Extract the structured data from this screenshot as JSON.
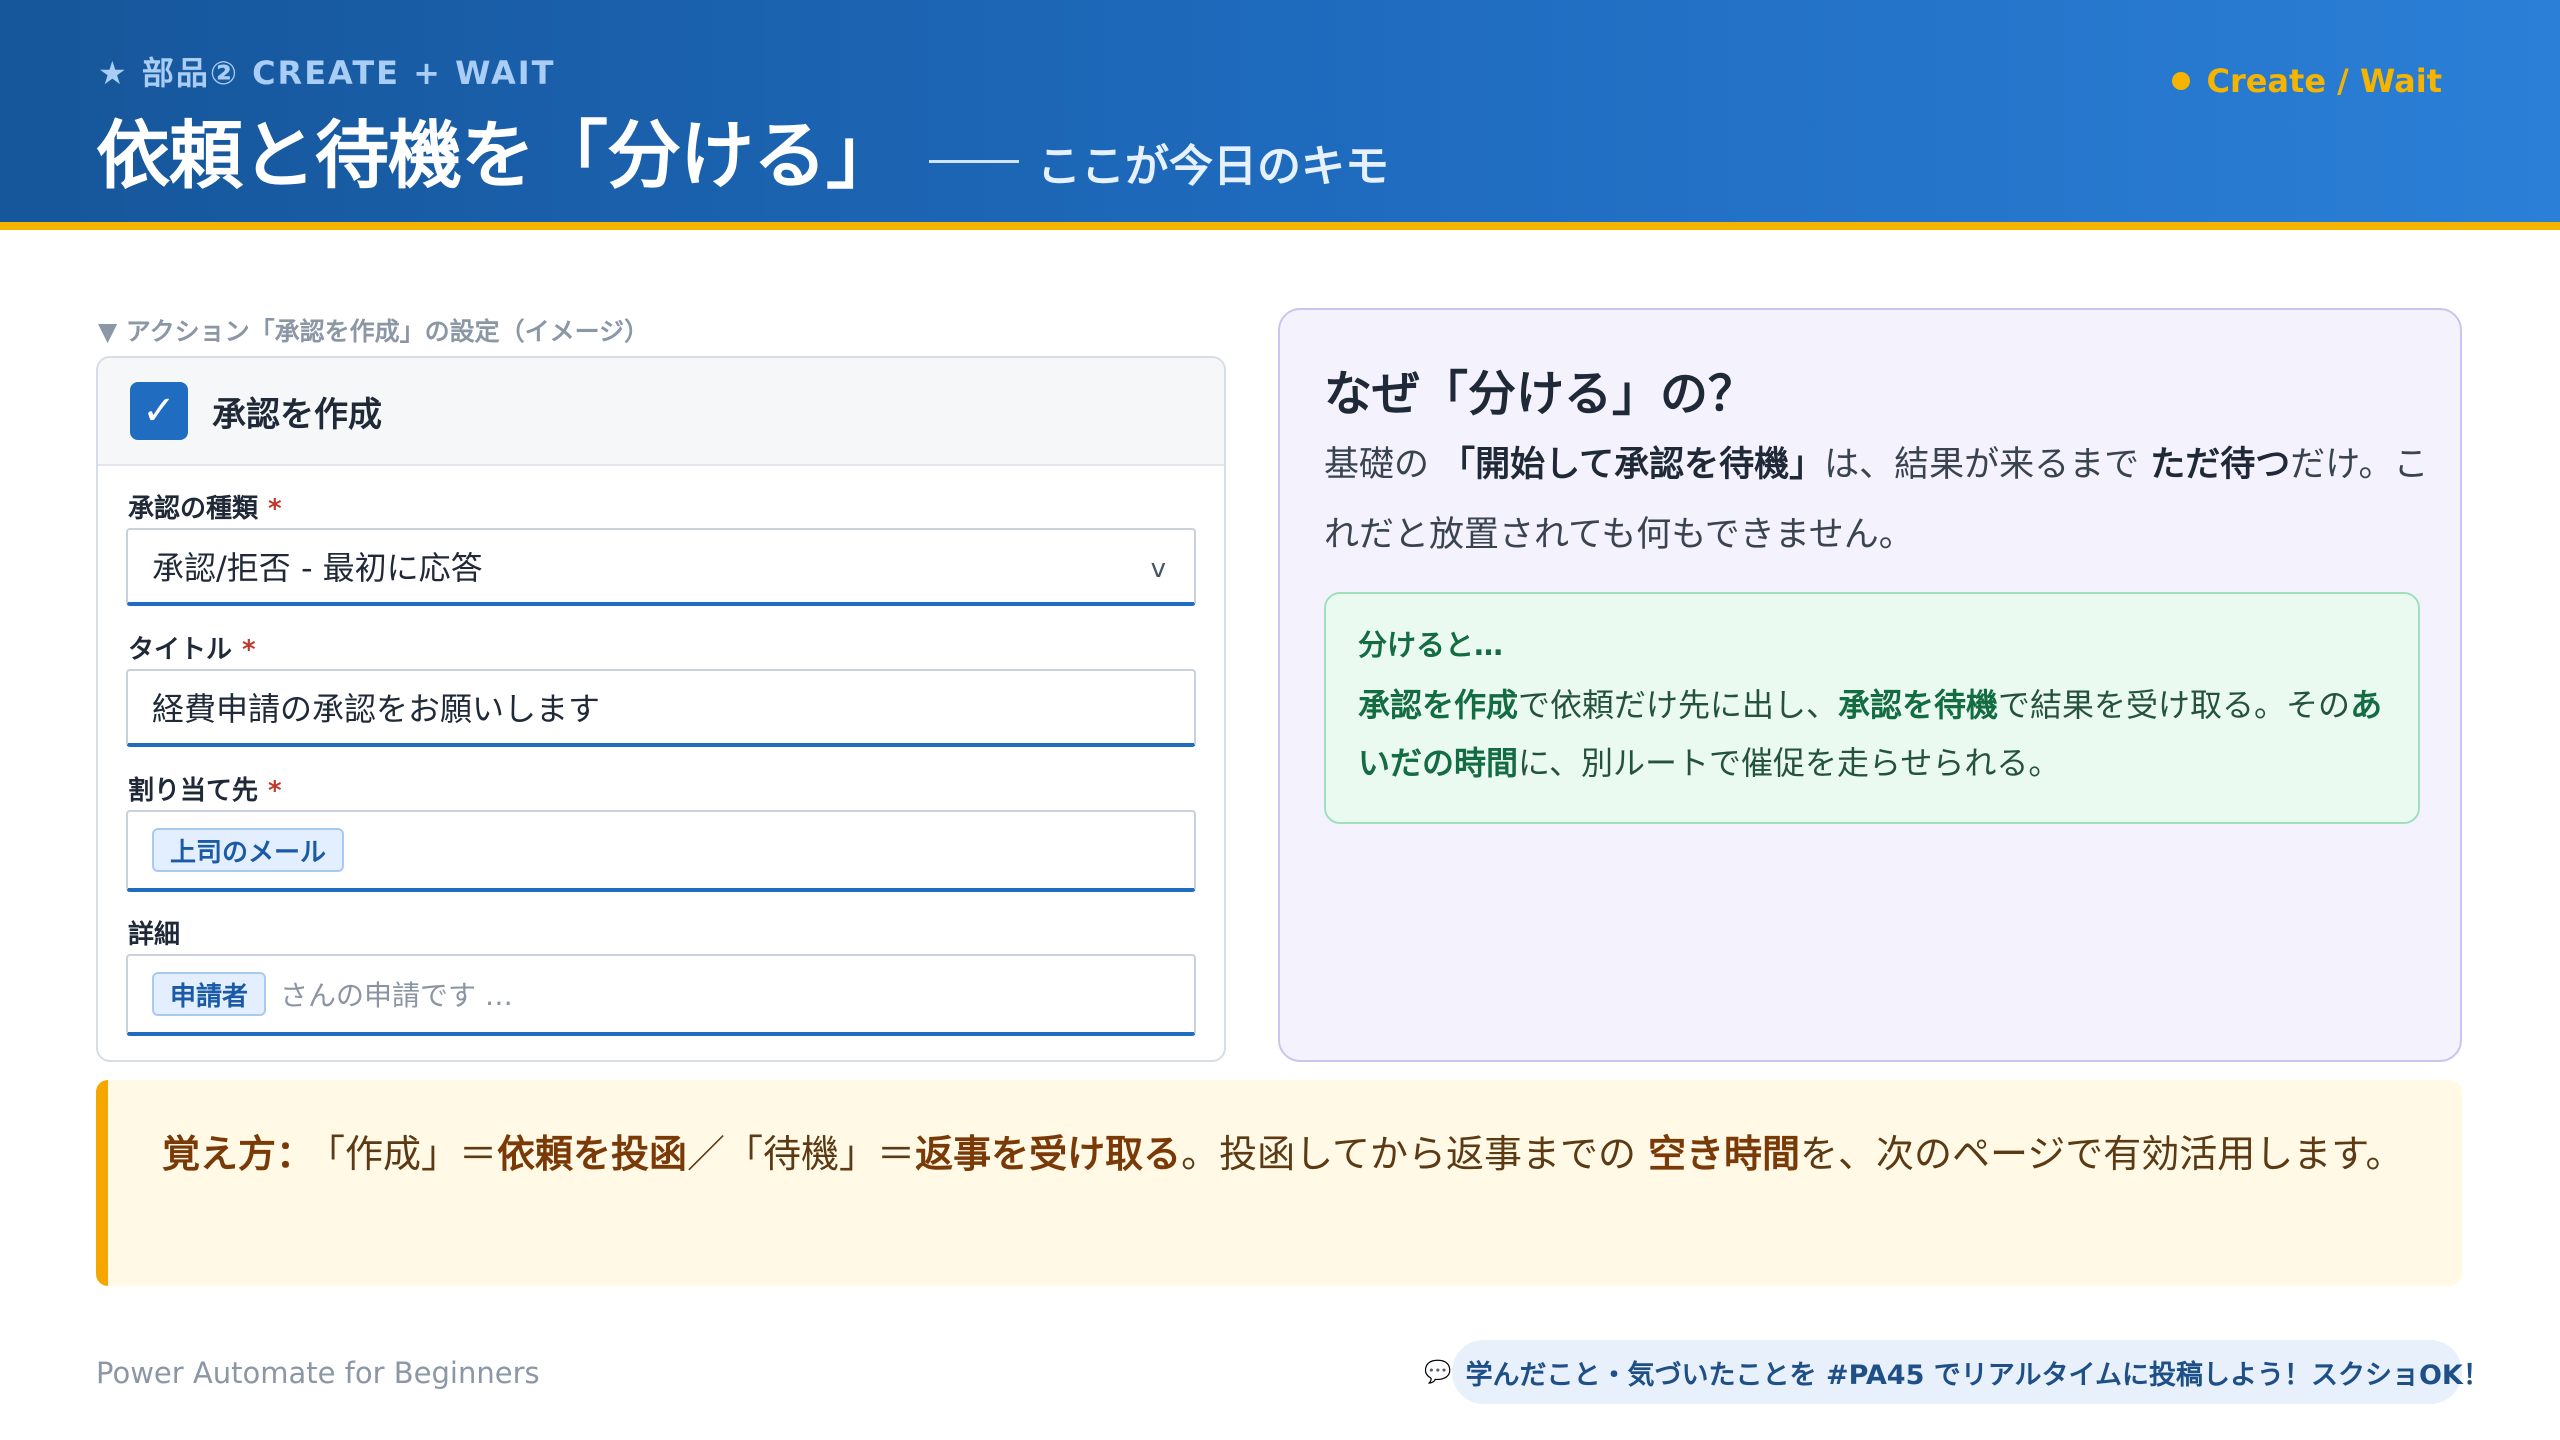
{
  "header": {
    "kicker": "★ 部品② CREATE + WAIT",
    "title": "依頼と待機を「分ける」",
    "subtitle": "ここが今日のキモ",
    "tag": "Create / Wait"
  },
  "form": {
    "caption": "▼ アクション「承認を作成」の設定（イメージ）",
    "card_title": "承認を作成",
    "fields": [
      {
        "label": "承認の種類",
        "required": "*",
        "value": "承認/拒否 - 最初に応答",
        "chevron": "v"
      },
      {
        "label": "タイトル",
        "required": "*",
        "value": "経費申請の承認をお願いします"
      },
      {
        "label": "割り当て先",
        "required": "*",
        "chip": "上司のメール"
      },
      {
        "label": "詳細",
        "chip": "申請者",
        "after_chip": "さんの申請です …"
      }
    ]
  },
  "panel": {
    "title": "なぜ「分ける」の？",
    "body_1": "基礎の ",
    "body_bold_1": "「開始して承認を待機」",
    "body_2": "は、結果が来るまで ",
    "body_bold_2": "ただ待つ",
    "body_3": "だけ。これだと放置されても何もできません。",
    "note_title": "分けると…",
    "note_bold_1": "承認を作成",
    "note_1": "で依頼だけ先に出し、",
    "note_bold_2": "承認を待機",
    "note_2": "で結果を受け取る。その",
    "note_bold_3": "あいだの時間",
    "note_3": "に、別ルートで催促を走らせられる。"
  },
  "tip": {
    "label": "覚え方：",
    "part_1": "「作成」＝",
    "bold_1": "依頼を投函",
    "part_2": "／「待機」＝",
    "bold_2": "返事を受け取る",
    "part_3": "。投函してから返事までの ",
    "bold_3": "空き時間",
    "part_4": "を、次のページで有効活用します。"
  },
  "footer": {
    "brand": "Power Automate for Beginners",
    "pill_icon": "speech-bubble-icon",
    "pill_text": "学んだこと・気づいたことを #PA45 でリアルタイムに投稿しよう！スクショOK！"
  },
  "colors": {
    "header_blue": "#1f6cc0",
    "accent_yellow": "#f5b400",
    "note_green": "#146c43",
    "tip_brown": "#7a3a07"
  }
}
